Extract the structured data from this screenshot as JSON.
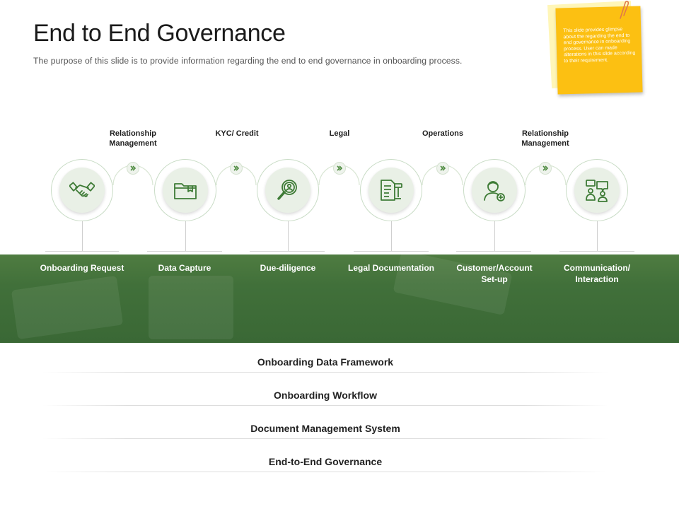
{
  "header": {
    "title": "End to End Governance",
    "subtitle": "The purpose of this slide is to provide information regarding the end to end governance in onboarding process."
  },
  "note": {
    "text": "This slide provides glimpse about the regarding the end to end governance in onboarding process. User can made alterations in this slide according to their requirement."
  },
  "steps": [
    {
      "category": "Relationship Management",
      "label": "Onboarding Request",
      "icon": "handshake-icon"
    },
    {
      "category": "KYC/ Credit",
      "label": "Data Capture",
      "icon": "folder-icon"
    },
    {
      "category": "",
      "label": "Due-diligence",
      "icon": "magnifier-person-icon"
    },
    {
      "category": "Legal",
      "label": "Legal Documentation",
      "icon": "legal-document-gavel-icon"
    },
    {
      "category": "Operations",
      "label": "Customer/Account Set-up",
      "icon": "customer-add-icon"
    },
    {
      "category": "Relationship Management",
      "label": "Communication/ Interaction",
      "icon": "chat-people-icon"
    }
  ],
  "framework": [
    "Onboarding Data Framework",
    "Onboarding Workflow",
    "Document Management System",
    "End-to-End Governance"
  ],
  "colors": {
    "band": "#41703a",
    "note": "#fcc012",
    "icon": "#3e7b36",
    "circle_fill": "#e9f0e6"
  }
}
